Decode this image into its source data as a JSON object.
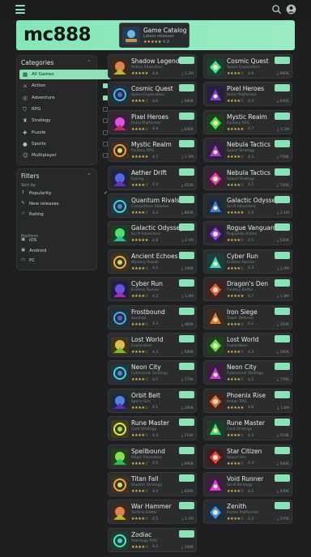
{
  "app": {
    "logo": "mc888",
    "accent": "#8fdfb7"
  },
  "topbar": {
    "menu_icon": "hamburger-icon",
    "search_icon": "search-icon",
    "account_icon": "account-icon"
  },
  "featured": {
    "title": "Game Catalog",
    "subtitle": "Latest releases",
    "stars": "★★★★★",
    "rating": "4.9"
  },
  "categories": {
    "heading": "Categories",
    "items": [
      {
        "label": "All Games",
        "icon": "grid-icon",
        "active": true,
        "checked": true
      },
      {
        "label": "Action",
        "icon": "sword-icon",
        "active": false,
        "checked": true
      },
      {
        "label": "Adventure",
        "icon": "compass-icon",
        "active": false,
        "checked": true
      },
      {
        "label": "RPG",
        "icon": "shield-icon",
        "active": false,
        "checked": false
      },
      {
        "label": "Strategy",
        "icon": "chess-icon",
        "active": false,
        "checked": false
      },
      {
        "label": "Puzzle",
        "icon": "puzzle-icon",
        "active": false,
        "checked": false
      },
      {
        "label": "Sports",
        "icon": "ball-icon",
        "active": false,
        "checked": false
      },
      {
        "label": "Multiplayer",
        "icon": "users-icon",
        "active": false,
        "checked": false
      }
    ]
  },
  "filters": {
    "heading": "Filters",
    "sort_label": "Sort by",
    "sort_options": [
      {
        "label": "Popularity",
        "checked": true
      },
      {
        "label": "New releases",
        "checked": false
      },
      {
        "label": "Rating",
        "checked": false
      }
    ],
    "platform_label": "Platform",
    "platforms": [
      {
        "label": "iOS"
      },
      {
        "label": "Android"
      },
      {
        "label": "PC"
      }
    ]
  },
  "games": [
    {
      "title": "Shadow Legends",
      "subtitle": "Action Adventure",
      "stars": "★★★★★",
      "rating": "4.8",
      "downloads": "1.2M",
      "hue": 20
    },
    {
      "title": "Cosmic Quest",
      "subtitle": "Space Exploration",
      "stars": "★★★★☆",
      "rating": "4.6",
      "downloads": "980K",
      "hue": 150
    },
    {
      "title": "Cosmic Quest",
      "subtitle": "Space Exploration",
      "stars": "★★★★☆",
      "rating": "4.6",
      "downloads": "980K",
      "hue": 200
    },
    {
      "title": "Pixel Heroes",
      "subtitle": "Retro Platformer",
      "stars": "★★★★☆",
      "rating": "4.4",
      "downloads": "640K",
      "hue": 260
    },
    {
      "title": "Pixel Heroes",
      "subtitle": "Retro Platformer",
      "stars": "★★★★☆",
      "rating": "4.4",
      "downloads": "640K",
      "hue": 300
    },
    {
      "title": "Mystic Realm",
      "subtitle": "Fantasy RPG",
      "stars": "★★★★★",
      "rating": "4.7",
      "downloads": "1.5M",
      "hue": 120
    },
    {
      "title": "Mystic Realm",
      "subtitle": "Fantasy RPG",
      "stars": "★★★★★",
      "rating": "4.7",
      "downloads": "1.5M",
      "hue": 30
    },
    {
      "title": "Nebula Tactics",
      "subtitle": "Space Strategy",
      "stars": "★★★★☆",
      "rating": "4.5",
      "downloads": "720K",
      "hue": 280
    },
    {
      "title": "Aether Drift",
      "subtitle": "Racing",
      "stars": "★★★★☆",
      "rating": "4.3",
      "downloads": "410K",
      "hue": 230
    },
    {
      "title": "Nebula Tactics",
      "subtitle": "Space Strategy",
      "stars": "★★★★☆",
      "rating": "4.5",
      "downloads": "720K",
      "hue": 320
    },
    {
      "title": "Quantum Rivals",
      "subtitle": "Competitive Shooter",
      "stars": "★★★★☆",
      "rating": "4.4",
      "downloads": "860K",
      "hue": 190
    },
    {
      "title": "Galactic Odyssey",
      "subtitle": "Sci-fi Adventure",
      "stars": "★★★★★",
      "rating": "4.8",
      "downloads": "2.1M",
      "hue": 215
    },
    {
      "title": "Galactic Odyssey",
      "subtitle": "Sci-fi Adventure",
      "stars": "★★★★★",
      "rating": "4.8",
      "downloads": "2.1M",
      "hue": 130
    },
    {
      "title": "Rogue Vanguard",
      "subtitle": "Roguelike Action",
      "stars": "★★★★☆",
      "rating": "4.5",
      "downloads": "530K",
      "hue": 270
    },
    {
      "title": "Ancient Echoes",
      "subtitle": "Mystery Puzzle",
      "stars": "★★★★☆",
      "rating": "4.2",
      "downloads": "390K",
      "hue": 40
    },
    {
      "title": "Cyber Run",
      "subtitle": "Endless Runner",
      "stars": "★★★★☆",
      "rating": "4.3",
      "downloads": "1.0M",
      "hue": 175
    },
    {
      "title": "Cyber Run",
      "subtitle": "Endless Runner",
      "stars": "★★★★☆",
      "rating": "4.3",
      "downloads": "1.0M",
      "hue": 250
    },
    {
      "title": "Dragon's Den",
      "subtitle": "Fantasy Battle",
      "stars": "★★★★★",
      "rating": "4.7",
      "downloads": "1.8M",
      "hue": 10
    },
    {
      "title": "Frostbound",
      "subtitle": "Survival",
      "stars": "★★★★☆",
      "rating": "4.4",
      "downloads": "460K",
      "hue": 205
    },
    {
      "title": "Iron Siege",
      "subtitle": "Tower Defense",
      "stars": "★★★★☆",
      "rating": "4.2",
      "downloads": "350K",
      "hue": 25
    },
    {
      "title": "Lost World",
      "subtitle": "Exploration",
      "stars": "★★★★☆",
      "rating": "4.3",
      "downloads": "580K",
      "hue": 45
    },
    {
      "title": "Lost World",
      "subtitle": "Exploration",
      "stars": "★★★★☆",
      "rating": "4.3",
      "downloads": "580K",
      "hue": 110
    },
    {
      "title": "Neon City",
      "subtitle": "Cyberpunk Strategy",
      "stars": "★★★★☆",
      "rating": "4.5",
      "downloads": "770K",
      "hue": 190
    },
    {
      "title": "Neon City",
      "subtitle": "Cyberpunk Strategy",
      "stars": "★★★★☆",
      "rating": "4.5",
      "downloads": "770K",
      "hue": 290
    },
    {
      "title": "Orbit Belt",
      "subtitle": "Space Sim",
      "stars": "★★★★☆",
      "rating": "4.1",
      "downloads": "290K",
      "hue": 220
    },
    {
      "title": "Phoenix Rise",
      "subtitle": "Action RPG",
      "stars": "★★★★★",
      "rating": "4.8",
      "downloads": "1.6M",
      "hue": 15
    },
    {
      "title": "Rune Master",
      "subtitle": "Card Strategy",
      "stars": "★★★★☆",
      "rating": "4.4",
      "downloads": "510K",
      "hue": 60
    },
    {
      "title": "Rune Master",
      "subtitle": "Card Strategy",
      "stars": "★★★★☆",
      "rating": "4.4",
      "downloads": "510K",
      "hue": 140
    },
    {
      "title": "Spellbound",
      "subtitle": "Magic Adventure",
      "stars": "★★★★☆",
      "rating": "4.5",
      "downloads": "690K",
      "hue": 100
    },
    {
      "title": "Star Citizen",
      "subtitle": "Space Sim",
      "stars": "★★★★☆",
      "rating": "4.3",
      "downloads": "940K",
      "hue": 0
    },
    {
      "title": "Titan Fall",
      "subtitle": "Shooter Strategy",
      "stars": "★★★★☆",
      "rating": "4.4",
      "downloads": "820K",
      "hue": 35
    },
    {
      "title": "Void Runner",
      "subtitle": "Sci-fi Strategy",
      "stars": "★★★★☆",
      "rating": "4.2",
      "downloads": "430K",
      "hue": 300
    },
    {
      "title": "War Hammer",
      "subtitle": "Tactical Battle",
      "stars": "★★★★☆",
      "rating": "4.5",
      "downloads": "1.1M",
      "hue": 20
    },
    {
      "title": "Zenith",
      "subtitle": "Puzzle Platformer",
      "stars": "★★★★☆",
      "rating": "4.3",
      "downloads": "370K",
      "hue": 210
    },
    {
      "title": "Zodiac",
      "subtitle": "Astrology RPG",
      "stars": "★★★★☆",
      "rating": "4.2",
      "downloads": "300K",
      "hue": 160
    }
  ]
}
